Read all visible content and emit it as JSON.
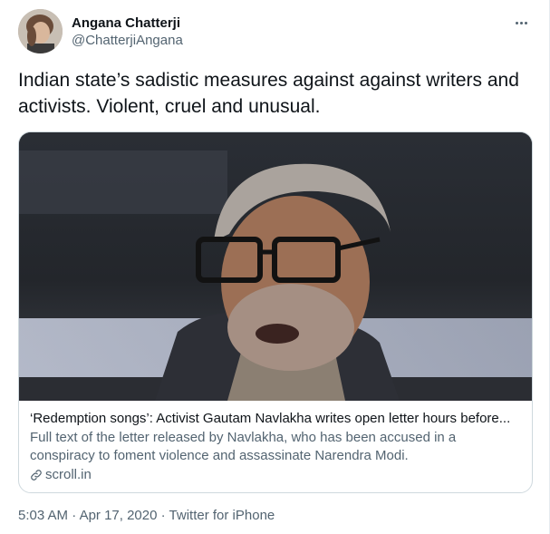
{
  "user": {
    "display_name": "Angana Chatterji",
    "handle": "@ChatterjiAngana"
  },
  "tweet": {
    "text": "Indian state’s sadistic measures against against writers and activists. Violent, cruel and unusual."
  },
  "card": {
    "title": "‘Redemption songs’: Activist Gautam Navlakha writes open letter hours before...",
    "description": "Full text of the letter released by Navlakha, who has been accused in a conspiracy to foment violence and assassinate Narendra Modi.",
    "domain": "scroll.in"
  },
  "meta": {
    "time": "5:03 AM",
    "separator": "·",
    "date": "Apr 17, 2020",
    "source": "Twitter for iPhone"
  },
  "icons": {
    "more": "more-horizontal-icon",
    "link": "link-icon"
  },
  "colors": {
    "text_primary": "#0f1419",
    "text_secondary": "#536471",
    "border": "#cfd9de"
  }
}
